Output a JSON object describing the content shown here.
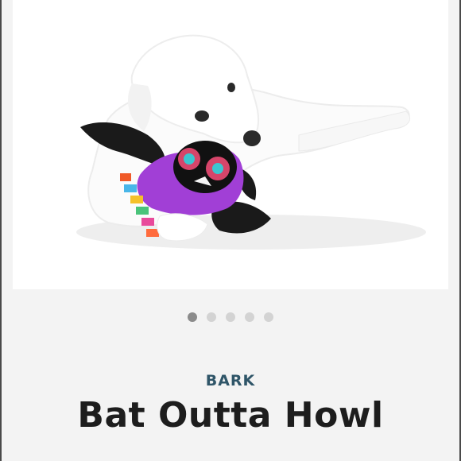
{
  "product": {
    "brand": "BARK",
    "title": "Bat Outta Howl",
    "image": {
      "subject": "white dog with plush bat toy",
      "alt_icon": "product-photo"
    },
    "gallery": {
      "count": 5,
      "active_index": 0
    }
  },
  "colors": {
    "background": "#f3f3f3",
    "brand_text": "#2f5568",
    "title_text": "#1d1d1d",
    "dot_active": "#8b8b8b",
    "dot_inactive": "#d3d3d3",
    "toy_purple": "#a13fd6"
  }
}
